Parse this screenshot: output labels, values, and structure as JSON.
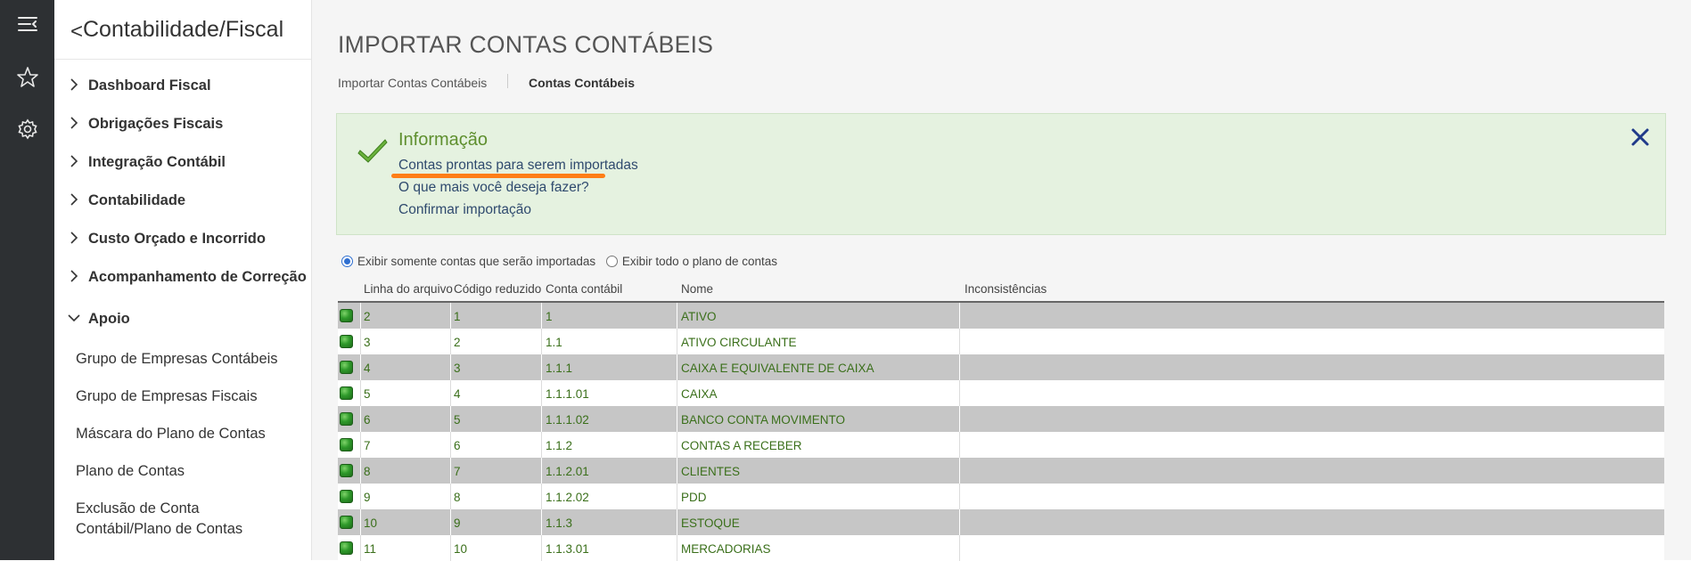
{
  "rail": {
    "icons": [
      "menu-collapse-icon",
      "star-icon",
      "gear-icon"
    ]
  },
  "nav": {
    "back_glyph": "<",
    "title": "Contabilidade/Fiscal",
    "items": [
      {
        "label": "Dashboard Fiscal",
        "expanded": false
      },
      {
        "label": "Obrigações Fiscais",
        "expanded": false
      },
      {
        "label": "Integração Contábil",
        "expanded": false
      },
      {
        "label": "Contabilidade",
        "expanded": false
      },
      {
        "label": "Custo Orçado e Incorrido",
        "expanded": false
      },
      {
        "label": "Acompanhamento de Correção",
        "expanded": false
      },
      {
        "label": "Apoio",
        "expanded": true
      }
    ],
    "subitems": [
      "Grupo de Empresas Contábeis",
      "Grupo de Empresas Fiscais",
      "Máscara do Plano de Contas",
      "Plano de Contas",
      "Exclusão de Conta Contábil/Plano de Contas"
    ]
  },
  "main": {
    "title": "IMPORTAR CONTAS CONTÁBEIS",
    "breadcrumb": [
      "Importar Contas Contábeis",
      "Contas Contábeis"
    ],
    "alert": {
      "title": "Informação",
      "message": "Contas prontas para serem importadas",
      "question": "O que mais você deseja fazer?",
      "action": "Confirmar importação"
    },
    "filter": {
      "options": [
        "Exibir somente contas que serão importadas",
        "Exibir todo o plano de contas"
      ],
      "selected": 0
    },
    "table": {
      "headers": [
        "Linha do arquivo",
        "Código reduzido",
        "Conta contábil",
        "Nome",
        "Inconsistências"
      ],
      "rows": [
        {
          "linha": "2",
          "codigo": "1",
          "conta": "1",
          "nome": "ATIVO",
          "inconsistencias": ""
        },
        {
          "linha": "3",
          "codigo": "2",
          "conta": "1.1",
          "nome": "ATIVO CIRCULANTE",
          "inconsistencias": ""
        },
        {
          "linha": "4",
          "codigo": "3",
          "conta": "1.1.1",
          "nome": "CAIXA E EQUIVALENTE DE CAIXA",
          "inconsistencias": ""
        },
        {
          "linha": "5",
          "codigo": "4",
          "conta": "1.1.1.01",
          "nome": "CAIXA",
          "inconsistencias": ""
        },
        {
          "linha": "6",
          "codigo": "5",
          "conta": "1.1.1.02",
          "nome": "BANCO CONTA MOVIMENTO",
          "inconsistencias": ""
        },
        {
          "linha": "7",
          "codigo": "6",
          "conta": "1.1.2",
          "nome": "CONTAS A RECEBER",
          "inconsistencias": ""
        },
        {
          "linha": "8",
          "codigo": "7",
          "conta": "1.1.2.01",
          "nome": "CLIENTES",
          "inconsistencias": ""
        },
        {
          "linha": "9",
          "codigo": "8",
          "conta": "1.1.2.02",
          "nome": "PDD",
          "inconsistencias": ""
        },
        {
          "linha": "10",
          "codigo": "9",
          "conta": "1.1.3",
          "nome": "ESTOQUE",
          "inconsistencias": ""
        },
        {
          "linha": "11",
          "codigo": "10",
          "conta": "1.1.3.01",
          "nome": "MERCADORIAS",
          "inconsistencias": ""
        }
      ]
    }
  },
  "colors": {
    "rail": "#2d3033",
    "alert_bg": "#e5f2e0",
    "alert_title": "#5e8f2e",
    "row_text": "#3a6f1a",
    "annotation": "#ff7e17",
    "status_ok": "#2f9a2b"
  }
}
